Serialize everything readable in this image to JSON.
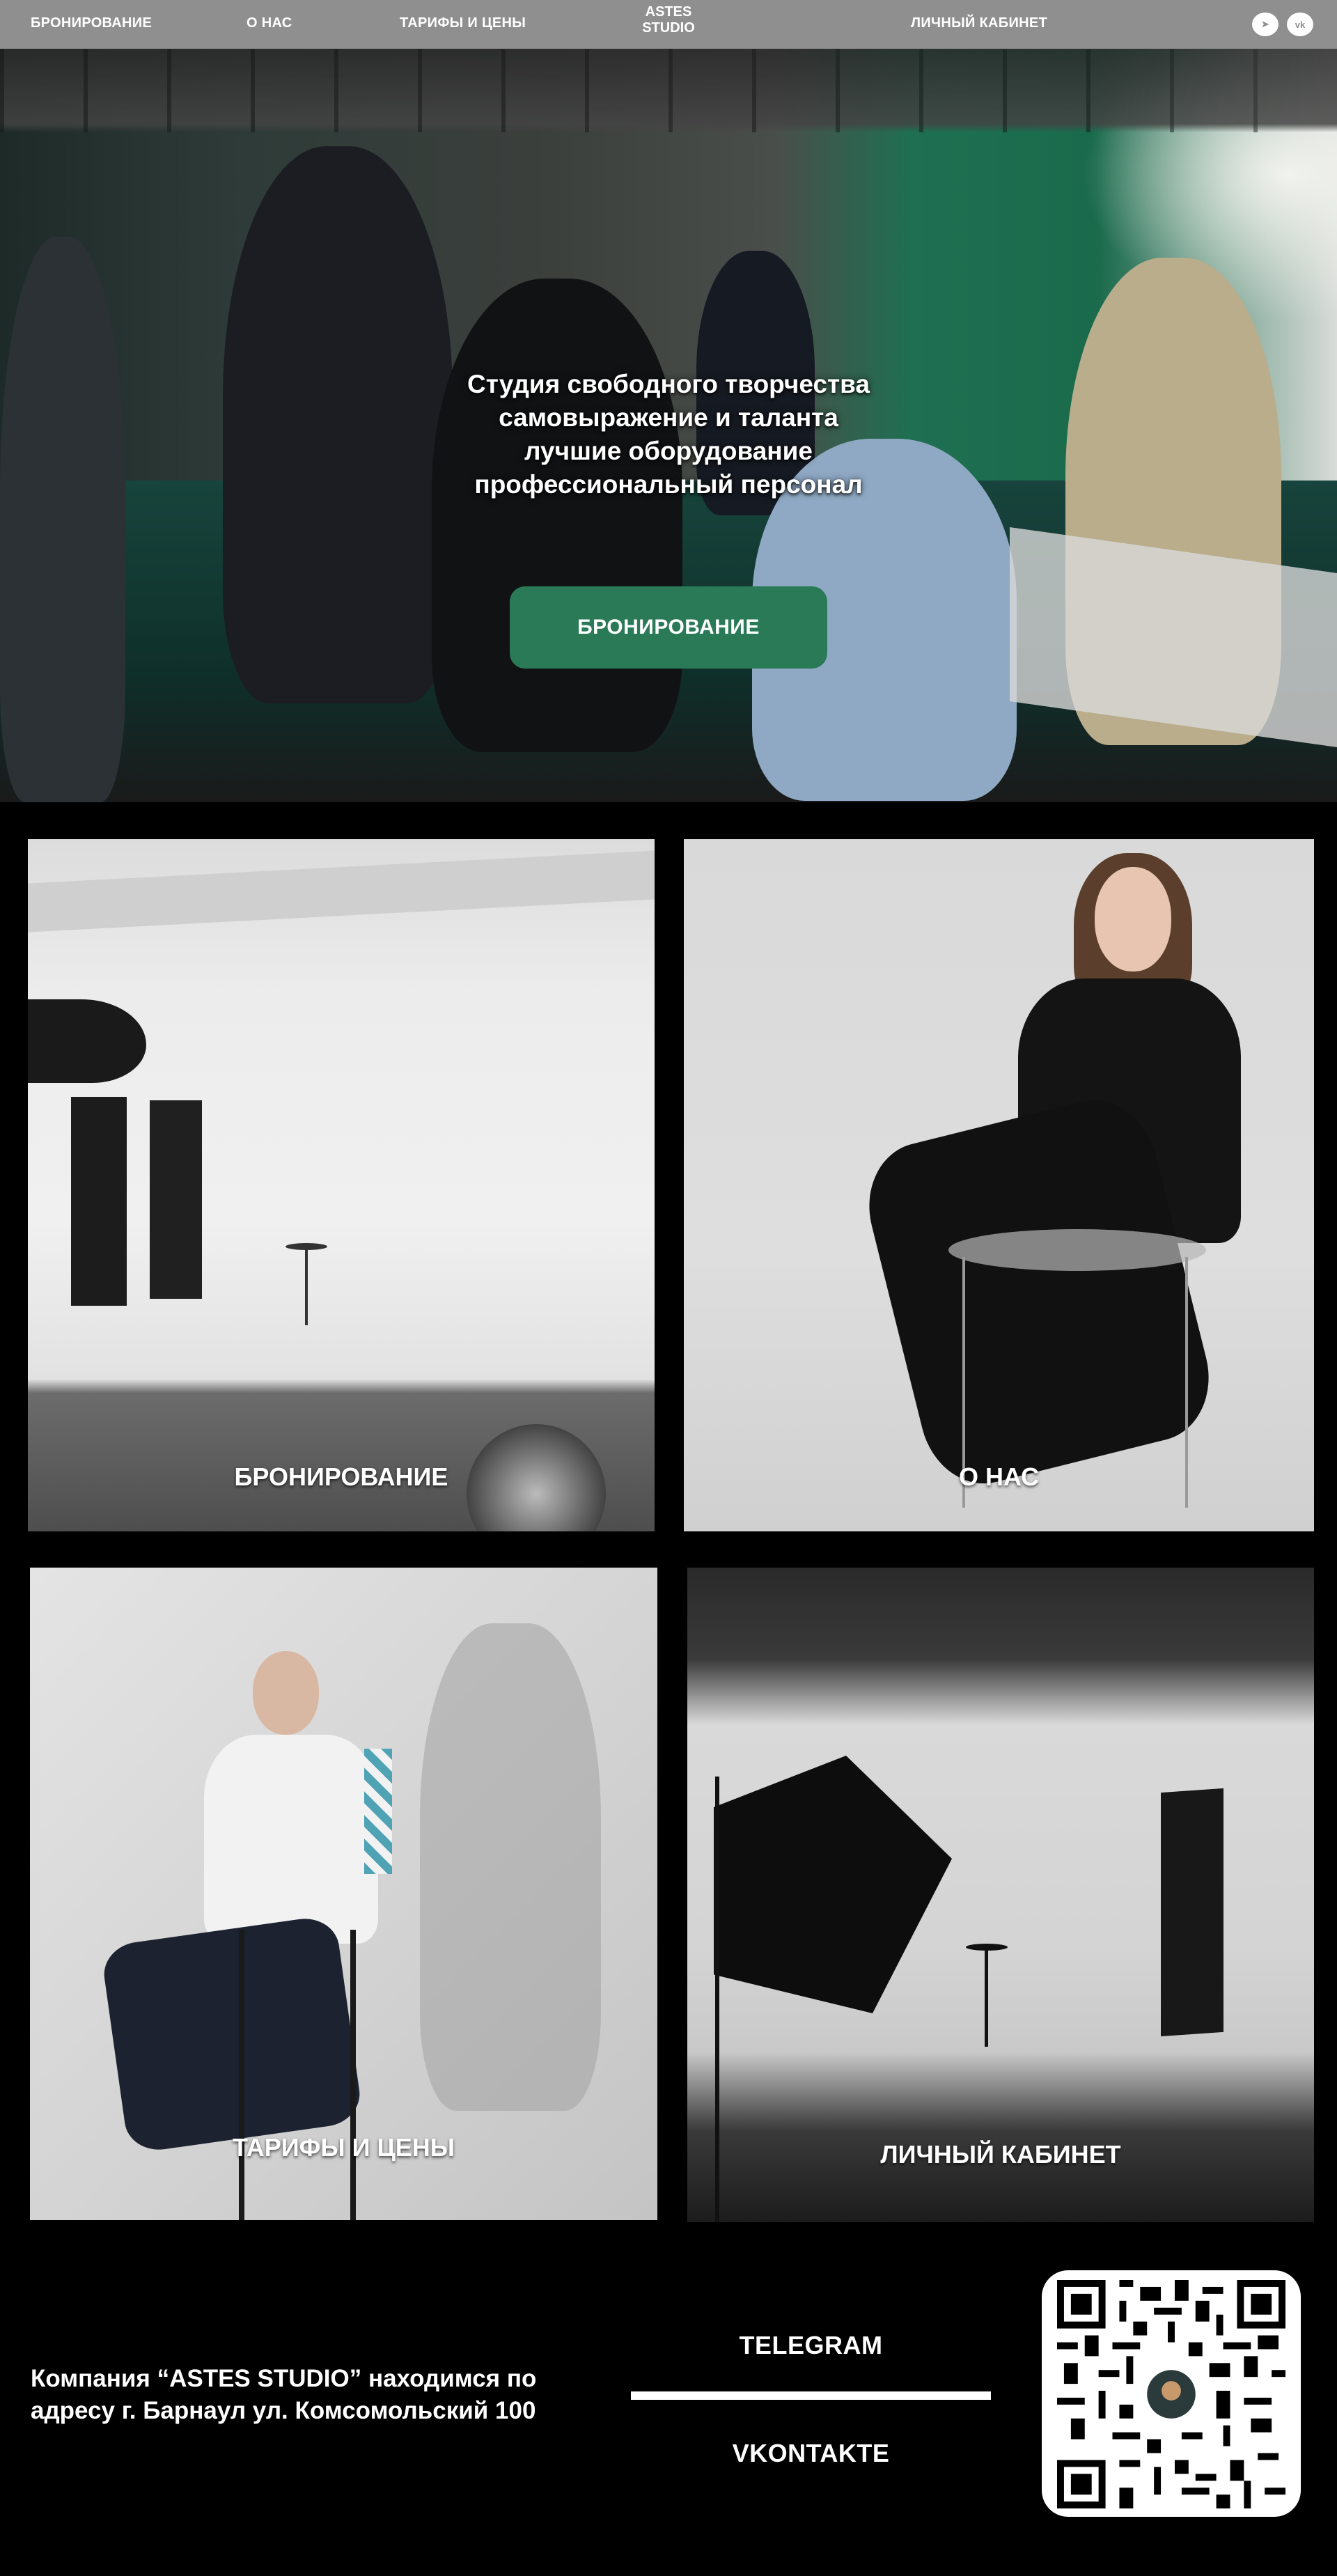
{
  "header": {
    "nav": [
      "БРОНИРОВАНИЕ",
      "О НАС",
      "ТАРИФЫ И ЦЕНЫ"
    ],
    "logo_line1": "ASTES",
    "logo_line2": "STUDIO",
    "account_link": "ЛИЧНЫЙ КАБИНЕТ",
    "social": [
      {
        "name": "telegram-icon",
        "glyph": "➤"
      },
      {
        "name": "vk-icon",
        "glyph": "vk"
      }
    ]
  },
  "hero": {
    "lines": [
      "Студия свободного творчества",
      "самовыражение и таланта",
      "лучшие оборудование",
      "профессиональный персонал"
    ],
    "button_label": "БРОНИРОВАНИЕ",
    "accent_color": "#2a7a58"
  },
  "cards": [
    {
      "label": "БРОНИРОВАНИЕ"
    },
    {
      "label": "О НАС"
    },
    {
      "label": "ТАРИФЫ И ЦЕНЫ"
    },
    {
      "label": "ЛИЧНЫЙ КАБИНЕТ"
    }
  ],
  "footer": {
    "address_line1": "Компания “ASTES STUDIO” находимся по",
    "address_line2": "адресу г. Барнаул ул. Комсомольский 100",
    "telegram_label": "TELEGRAM",
    "vk_label": "VKONTAKTE"
  }
}
